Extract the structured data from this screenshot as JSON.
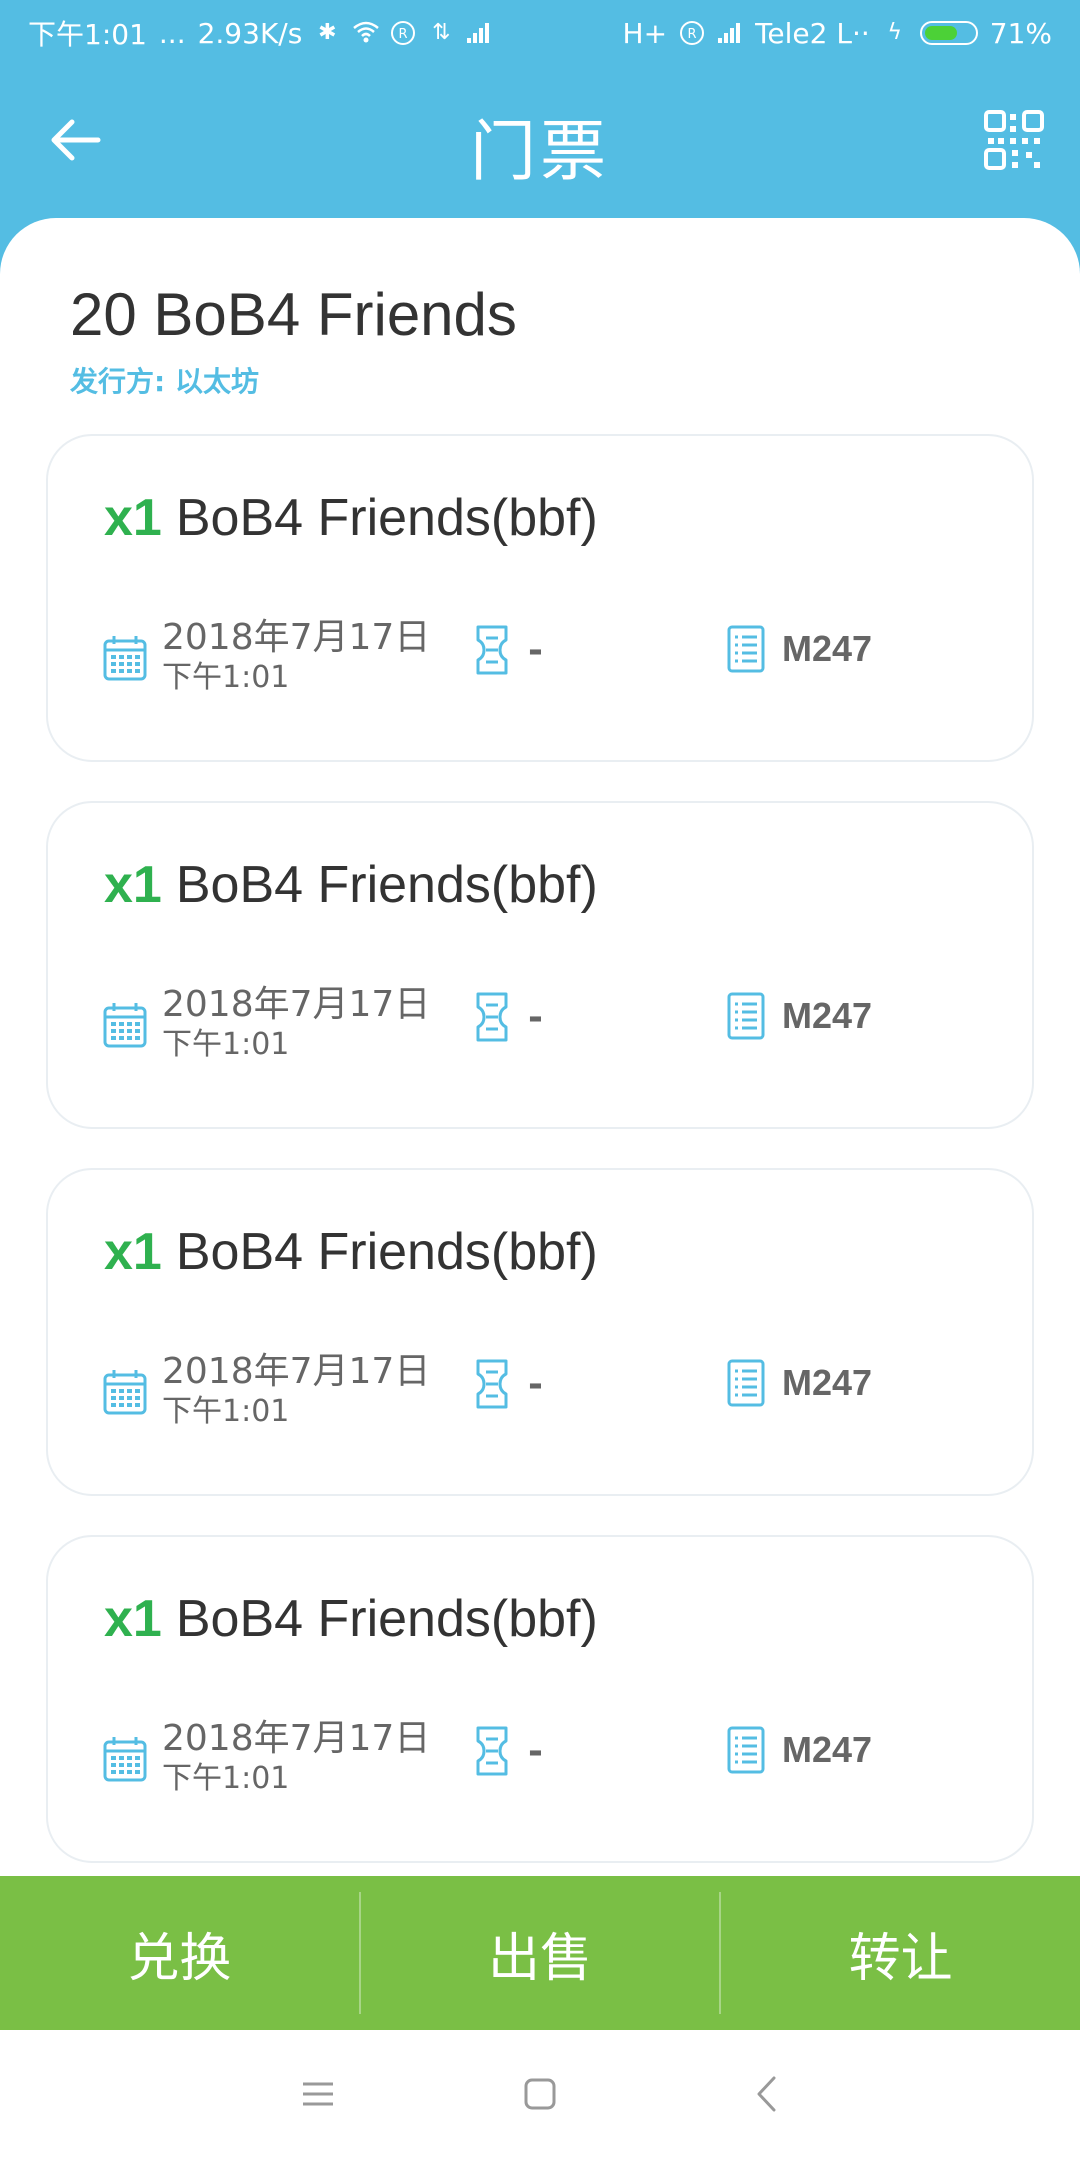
{
  "status_bar": {
    "time": "下午1:01",
    "dots": "...",
    "speed": "2.93K/s",
    "network_1": "H+",
    "carrier": "Tele2 L··",
    "battery": "71%",
    "battery_level": 0.71
  },
  "header": {
    "title": "门票"
  },
  "token": {
    "title": "20 BoB4 Friends",
    "issuer": "发行方: 以太坊"
  },
  "tickets": [
    {
      "qty": "x1",
      "name": "BoB4 Friends(bbf)",
      "date": "2018年7月17日",
      "time": "下午1:01",
      "ticket_value": "-",
      "code": "M247"
    },
    {
      "qty": "x1",
      "name": "BoB4 Friends(bbf)",
      "date": "2018年7月17日",
      "time": "下午1:01",
      "ticket_value": "-",
      "code": "M247"
    },
    {
      "qty": "x1",
      "name": "BoB4 Friends(bbf)",
      "date": "2018年7月17日",
      "time": "下午1:01",
      "ticket_value": "-",
      "code": "M247"
    },
    {
      "qty": "x1",
      "name": "BoB4 Friends(bbf)",
      "date": "2018年7月17日",
      "time": "下午1:01",
      "ticket_value": "-",
      "code": "M247"
    }
  ],
  "actions": {
    "redeem": "兑换",
    "sell": "出售",
    "transfer": "转让"
  },
  "colors": {
    "accent": "#54bde3",
    "action_bar": "#7abf45",
    "quantity": "#2fb14f"
  },
  "icons": {
    "back": "arrow-left-icon",
    "qr": "qr-code-icon",
    "calendar": "calendar-icon",
    "ticket": "ticket-icon",
    "code": "document-list-icon"
  }
}
